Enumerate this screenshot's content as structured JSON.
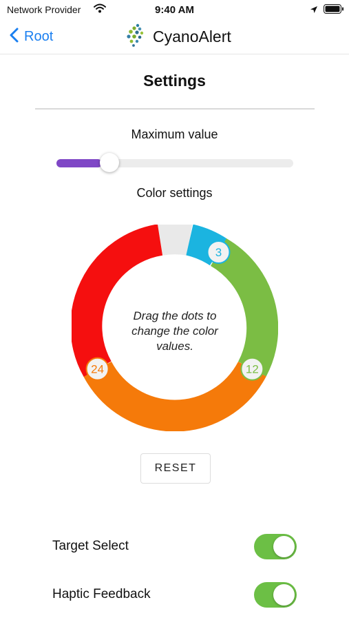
{
  "status_bar": {
    "carrier": "Network Provider",
    "time": "9:40 AM",
    "icons": [
      "wifi-icon",
      "location-arrow-icon",
      "battery-icon"
    ]
  },
  "nav": {
    "back_label": "Root",
    "app_name": "CyanoAlert",
    "logo_icon": "cyanoalert-logo-icon",
    "accent_color": "#1a7ff0"
  },
  "settings": {
    "title": "Settings",
    "max_value_label": "Maximum value",
    "slider_fraction": 0.18,
    "slider_color": "#7f47c6",
    "color_settings_label": "Color settings",
    "ring_hint": "Drag the dots to change the color values.",
    "ring_stops": [
      {
        "value": "3",
        "color": "#1bb4e0"
      },
      {
        "value": "12",
        "color": "#7bbd44"
      },
      {
        "value": "24",
        "color": "#f57a0a"
      }
    ],
    "ring_colors": {
      "blank": "#e9e9e9",
      "red": "#f50f0f"
    },
    "reset_label": "RESET"
  },
  "toggles": [
    {
      "label": "Target Select",
      "on": true
    },
    {
      "label": "Haptic Feedback",
      "on": true
    }
  ],
  "toggle_color": "#6cbf45"
}
